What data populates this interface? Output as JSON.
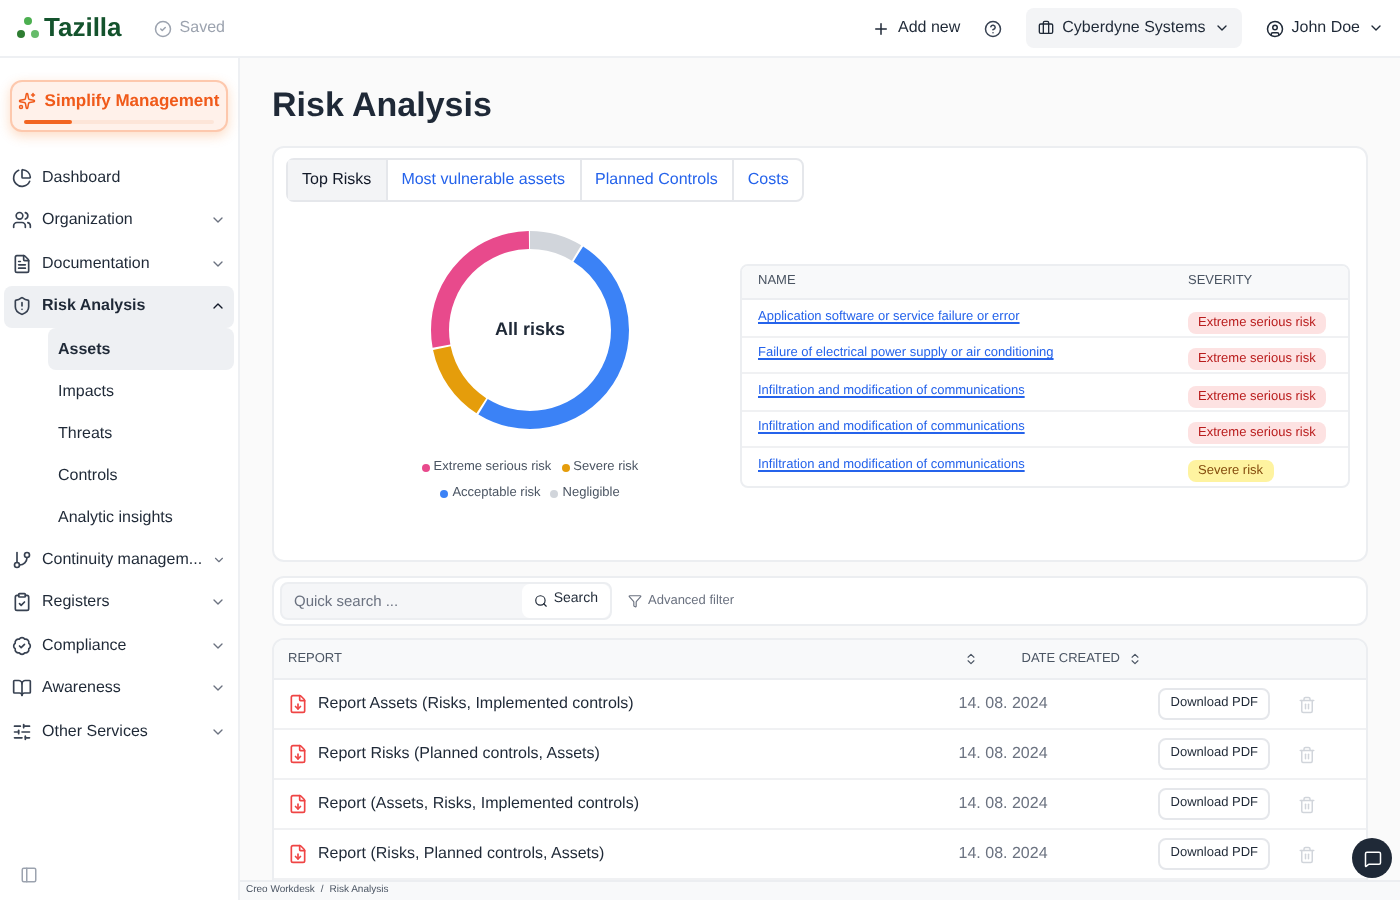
{
  "header": {
    "logo": "Tazilla",
    "saved": "Saved",
    "add_new": "Add new",
    "company": "Cyberdyne Systems",
    "user": "John Doe"
  },
  "promo": {
    "label": "Simplify Management",
    "level": 0.25
  },
  "sidebar": {
    "items": [
      {
        "label": "Dashboard",
        "kind": "link",
        "selected": false
      },
      {
        "label": "Organization",
        "kind": "group",
        "expanded": false,
        "selected": false
      },
      {
        "label": "Documentation",
        "kind": "group",
        "expanded": false,
        "selected": false
      },
      {
        "label": "Risk Analysis",
        "kind": "group",
        "expanded": true,
        "selected": true,
        "children": [
          {
            "label": "Assets",
            "selected": true
          },
          {
            "label": "Impacts",
            "selected": false
          },
          {
            "label": "Threats",
            "selected": false
          },
          {
            "label": "Controls",
            "selected": false
          },
          {
            "label": "Analytic insights",
            "selected": false
          }
        ]
      },
      {
        "label": "Continuity managem...",
        "kind": "group",
        "expanded": false,
        "selected": false
      },
      {
        "label": "Registers",
        "kind": "group",
        "expanded": false,
        "selected": false
      },
      {
        "label": "Compliance",
        "kind": "group",
        "expanded": false,
        "selected": false
      },
      {
        "label": "Awareness",
        "kind": "group",
        "expanded": false,
        "selected": false
      },
      {
        "label": "Other Services",
        "kind": "group",
        "expanded": false,
        "selected": false
      }
    ]
  },
  "page": {
    "title": "Risk Analysis"
  },
  "tabs": [
    {
      "label": "Top Risks",
      "selected": true
    },
    {
      "label": "Most vulnerable assets",
      "selected": false
    },
    {
      "label": "Planned Controls",
      "selected": false
    },
    {
      "label": "Costs",
      "selected": false
    }
  ],
  "donut": {
    "center": "All risks",
    "legend": [
      {
        "label": "Extreme serious risk",
        "color": "#e84a8c"
      },
      {
        "label": "Severe risk",
        "color": "#e59d0b"
      },
      {
        "label": "Acceptable risk",
        "color": "#3b82f6"
      },
      {
        "label": "Negligible",
        "color": "#d1d5db"
      }
    ]
  },
  "risk_table": {
    "columns": [
      "NAME",
      "SEVERITY"
    ],
    "rows": [
      {
        "name": "Application software or service failure or error",
        "severity": "Extreme serious risk",
        "kind": "extreme"
      },
      {
        "name": "Failure of electrical power supply or air conditioning",
        "severity": "Extreme serious risk",
        "kind": "extreme"
      },
      {
        "name": "Infiltration and modification of communications",
        "severity": "Extreme serious risk",
        "kind": "extreme"
      },
      {
        "name": "Infiltration and modification of communications",
        "severity": "Extreme serious risk",
        "kind": "extreme"
      },
      {
        "name": "Infiltration and modification of communications",
        "severity": "Severe risk",
        "kind": "severe"
      }
    ]
  },
  "filter": {
    "placeholder": "Quick search ...",
    "search": "Search",
    "advanced": "Advanced filter"
  },
  "reports": {
    "columns": [
      "REPORT",
      "DATE CREATED"
    ],
    "rows": [
      {
        "name": "Report Assets (Risks, Implemented controls)",
        "date": "14. 08. 2024",
        "action": "Download PDF"
      },
      {
        "name": "Report Risks (Planned controls, Assets)",
        "date": "14. 08. 2024",
        "action": "Download PDF"
      },
      {
        "name": "Report (Assets, Risks, Implemented controls)",
        "date": "14. 08. 2024",
        "action": "Download PDF"
      },
      {
        "name": "Report (Risks, Planned controls, Assets)",
        "date": "14. 08. 2024",
        "action": "Download PDF"
      }
    ]
  },
  "breadcrumb": {
    "items": [
      "Creo Workdesk",
      "Risk Analysis"
    ],
    "separator": "/"
  }
}
